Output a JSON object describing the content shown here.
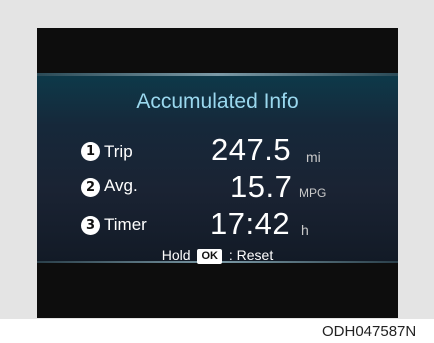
{
  "display": {
    "title": "Accumulated Info",
    "rows": [
      {
        "marker": "1",
        "label": "Trip",
        "value": "247.5",
        "unit": "mi"
      },
      {
        "marker": "2",
        "label": "Avg.",
        "value": "15.7",
        "unit": "MPG"
      },
      {
        "marker": "3",
        "label": "Timer",
        "value": "17:42",
        "unit": "h"
      }
    ],
    "hold": {
      "prefix": "Hold",
      "key": "OK",
      "suffix": ": Reset"
    }
  },
  "caption": "ODH047587N",
  "colors": {
    "title": "#9ad8ee",
    "screen": "#0d0d0d",
    "panel": "#1a2333"
  }
}
